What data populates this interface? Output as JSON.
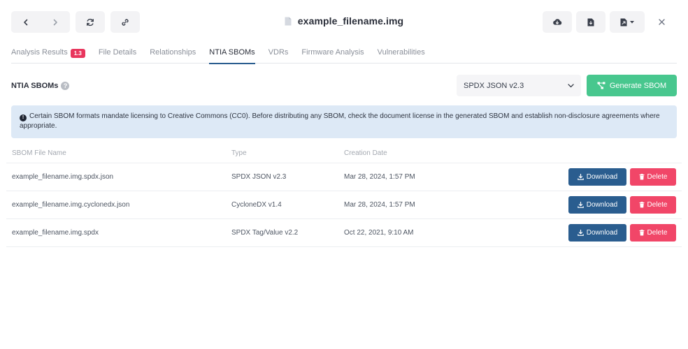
{
  "header": {
    "title": "example_filename.img"
  },
  "tabs": [
    {
      "label": "Analysis Results",
      "badge": "1.3"
    },
    {
      "label": "File Details"
    },
    {
      "label": "Relationships"
    },
    {
      "label": "NTIA SBOMs",
      "active": true
    },
    {
      "label": "VDRs"
    },
    {
      "label": "Firmware Analysis"
    },
    {
      "label": "Vulnerabilities"
    }
  ],
  "section": {
    "title": "NTIA SBOMs",
    "help": "?",
    "format_select": "SPDX JSON v2.3",
    "generate_label": "Generate SBOM"
  },
  "notice": {
    "icon": "!",
    "text": "Certain SBOM formats mandate licensing to Creative Commons (CC0). Before distributing any SBOM, check the document license in the generated SBOM and establish non-disclosure agreements where appropriate."
  },
  "table": {
    "headers": [
      "SBOM File Name",
      "Type",
      "Creation Date"
    ],
    "rows": [
      {
        "name": "example_filename.img.spdx.json",
        "type": "SPDX JSON v2.3",
        "date": "Mar 28, 2024, 1:57 PM"
      },
      {
        "name": "example_filename.img.cyclonedx.json",
        "type": "CycloneDX v1.4",
        "date": "Mar 28, 2024, 1:57 PM"
      },
      {
        "name": "example_filename.img.spdx",
        "type": "SPDX Tag/Value v2.2",
        "date": "Oct 22, 2021, 9:10 AM"
      }
    ],
    "download_label": "Download",
    "delete_label": "Delete"
  },
  "colors": {
    "accent": "#2a5d8f",
    "success": "#48c78e",
    "danger": "#f14668",
    "badge": "#e8365d",
    "notice_bg": "#dde9f6"
  },
  "icons": {
    "back": "chevron-left-icon",
    "forward": "chevron-right-icon",
    "refresh": "refresh-icon",
    "link": "link-icon",
    "file": "file-icon",
    "cloud": "cloud-download-icon",
    "report": "file-report-icon",
    "export": "file-export-icon",
    "close": "close-icon"
  }
}
